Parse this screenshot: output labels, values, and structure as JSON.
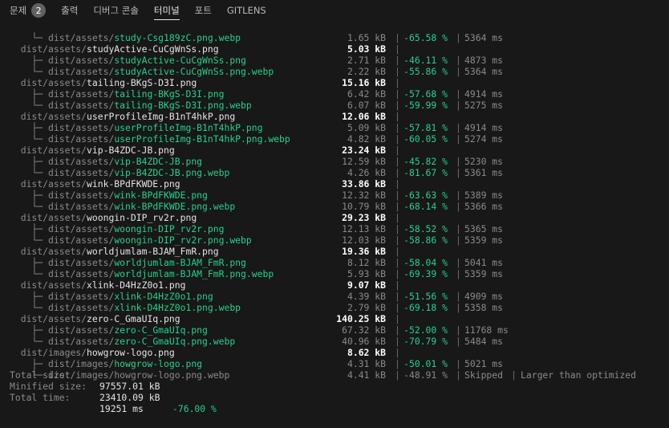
{
  "panel": {
    "tabs": [
      {
        "label": "문제",
        "badge": "2"
      },
      {
        "label": "출력"
      },
      {
        "label": "디버그 콘솔"
      },
      {
        "label": "터미널"
      },
      {
        "label": "포트"
      },
      {
        "label": "GITLENS"
      }
    ],
    "active_tab": "터미널"
  },
  "terminal": {
    "rows": [
      {
        "kind": "child",
        "tree": "└─ ",
        "dir": "dist/assets/",
        "file": "study-Csg189zC.png.webp",
        "size": "1.65 kB",
        "pct": "-65.58 %",
        "time": "5364 ms"
      },
      {
        "kind": "parent",
        "dir": "dist/assets/",
        "file": "studyActive-CuCgWnSs.png",
        "size": "5.03 kB"
      },
      {
        "kind": "child",
        "tree": "├─ ",
        "dir": "dist/assets/",
        "file": "studyActive-CuCgWnSs.png",
        "size": "2.71 kB",
        "pct": "-46.11 %",
        "time": "4873 ms"
      },
      {
        "kind": "child",
        "tree": "└─ ",
        "dir": "dist/assets/",
        "file": "studyActive-CuCgWnSs.png.webp",
        "size": "2.22 kB",
        "pct": "-55.86 %",
        "time": "5364 ms"
      },
      {
        "kind": "parent",
        "dir": "dist/assets/",
        "file": "tailing-BKgS-D3I.png",
        "size": "15.16 kB"
      },
      {
        "kind": "child",
        "tree": "├─ ",
        "dir": "dist/assets/",
        "file": "tailing-BKgS-D3I.png",
        "size": "6.42 kB",
        "pct": "-57.68 %",
        "time": "4914 ms"
      },
      {
        "kind": "child",
        "tree": "└─ ",
        "dir": "dist/assets/",
        "file": "tailing-BKgS-D3I.png.webp",
        "size": "6.07 kB",
        "pct": "-59.99 %",
        "time": "5275 ms"
      },
      {
        "kind": "parent",
        "dir": "dist/assets/",
        "file": "userProfileImg-B1nT4hkP.png",
        "size": "12.06 kB"
      },
      {
        "kind": "child",
        "tree": "├─ ",
        "dir": "dist/assets/",
        "file": "userProfileImg-B1nT4hkP.png",
        "size": "5.09 kB",
        "pct": "-57.81 %",
        "time": "4914 ms"
      },
      {
        "kind": "child",
        "tree": "└─ ",
        "dir": "dist/assets/",
        "file": "userProfileImg-B1nT4hkP.png.webp",
        "size": "4.82 kB",
        "pct": "-60.05 %",
        "time": "5274 ms"
      },
      {
        "kind": "parent",
        "dir": "dist/assets/",
        "file": "vip-B4ZDC-JB.png",
        "size": "23.24 kB"
      },
      {
        "kind": "child",
        "tree": "├─ ",
        "dir": "dist/assets/",
        "file": "vip-B4ZDC-JB.png",
        "size": "12.59 kB",
        "pct": "-45.82 %",
        "time": "5230 ms"
      },
      {
        "kind": "child",
        "tree": "└─ ",
        "dir": "dist/assets/",
        "file": "vip-B4ZDC-JB.png.webp",
        "size": "4.26 kB",
        "pct": "-81.67 %",
        "time": "5361 ms"
      },
      {
        "kind": "parent",
        "dir": "dist/assets/",
        "file": "wink-BPdFKWDE.png",
        "size": "33.86 kB"
      },
      {
        "kind": "child",
        "tree": "├─ ",
        "dir": "dist/assets/",
        "file": "wink-BPdFKWDE.png",
        "size": "12.32 kB",
        "pct": "-63.63 %",
        "time": "5389 ms"
      },
      {
        "kind": "child",
        "tree": "└─ ",
        "dir": "dist/assets/",
        "file": "wink-BPdFKWDE.png.webp",
        "size": "10.79 kB",
        "pct": "-68.14 %",
        "time": "5366 ms"
      },
      {
        "kind": "parent",
        "dir": "dist/assets/",
        "file": "woongin-DIP_rv2r.png",
        "size": "29.23 kB"
      },
      {
        "kind": "child",
        "tree": "├─ ",
        "dir": "dist/assets/",
        "file": "woongin-DIP_rv2r.png",
        "size": "12.13 kB",
        "pct": "-58.52 %",
        "time": "5365 ms"
      },
      {
        "kind": "child",
        "tree": "└─ ",
        "dir": "dist/assets/",
        "file": "woongin-DIP_rv2r.png.webp",
        "size": "12.03 kB",
        "pct": "-58.86 %",
        "time": "5359 ms"
      },
      {
        "kind": "parent",
        "dir": "dist/assets/",
        "file": "worldjumlam-BJAM_FmR.png",
        "size": "19.36 kB"
      },
      {
        "kind": "child",
        "tree": "├─ ",
        "dir": "dist/assets/",
        "file": "worldjumlam-BJAM_FmR.png",
        "size": "8.12 kB",
        "pct": "-58.04 %",
        "time": "5041 ms"
      },
      {
        "kind": "child",
        "tree": "└─ ",
        "dir": "dist/assets/",
        "file": "worldjumlam-BJAM_FmR.png.webp",
        "size": "5.93 kB",
        "pct": "-69.39 %",
        "time": "5359 ms"
      },
      {
        "kind": "parent",
        "dir": "dist/assets/",
        "file": "xlink-D4HzZ0o1.png",
        "size": "9.07 kB"
      },
      {
        "kind": "child",
        "tree": "├─ ",
        "dir": "dist/assets/",
        "file": "xlink-D4HzZ0o1.png",
        "size": "4.39 kB",
        "pct": "-51.56 %",
        "time": "4909 ms"
      },
      {
        "kind": "child",
        "tree": "└─ ",
        "dir": "dist/assets/",
        "file": "xlink-D4HzZ0o1.png.webp",
        "size": "2.79 kB",
        "pct": "-69.18 %",
        "time": "5358 ms"
      },
      {
        "kind": "parent",
        "dir": "dist/assets/",
        "file": "zero-C_GmaUIq.png",
        "size": "140.25 kB"
      },
      {
        "kind": "child",
        "tree": "├─ ",
        "dir": "dist/assets/",
        "file": "zero-C_GmaUIq.png",
        "size": "67.32 kB",
        "pct": "-52.00 %",
        "time": "11768 ms"
      },
      {
        "kind": "child",
        "tree": "└─ ",
        "dir": "dist/assets/",
        "file": "zero-C_GmaUIq.png.webp",
        "size": "40.96 kB",
        "pct": "-70.79 %",
        "time": "5484 ms"
      },
      {
        "kind": "parent",
        "dir": "dist/images/",
        "file": "howgrow-logo.png",
        "size": "8.62 kB"
      },
      {
        "kind": "child",
        "tree": "├─ ",
        "dir": "dist/images/",
        "file": "howgrow-logo.png",
        "size": "4.31 kB",
        "pct": "-50.01 %",
        "time": "5021 ms"
      },
      {
        "kind": "skipped",
        "tree": "└─ ",
        "dir": "dist/images/",
        "file": "howgrow-logo.png.webp",
        "size": "4.41 kB",
        "pct": "-48.91 %",
        "time": "Skipped",
        "note": "Larger than optimized"
      }
    ],
    "summary": {
      "total_size_label": "Total size:",
      "total_size": "97557.01 kB",
      "minified_label": "Minified size:",
      "minified_size": "23410.09 kB",
      "minified_pct": "-76.00 %",
      "total_time_label": "Total time:",
      "total_time": "19251 ms"
    },
    "separator": "|"
  },
  "colors": {
    "background": "#181818",
    "green": "#23d18b",
    "dim": "#8a8a8a",
    "text": "#e5e5e5"
  }
}
